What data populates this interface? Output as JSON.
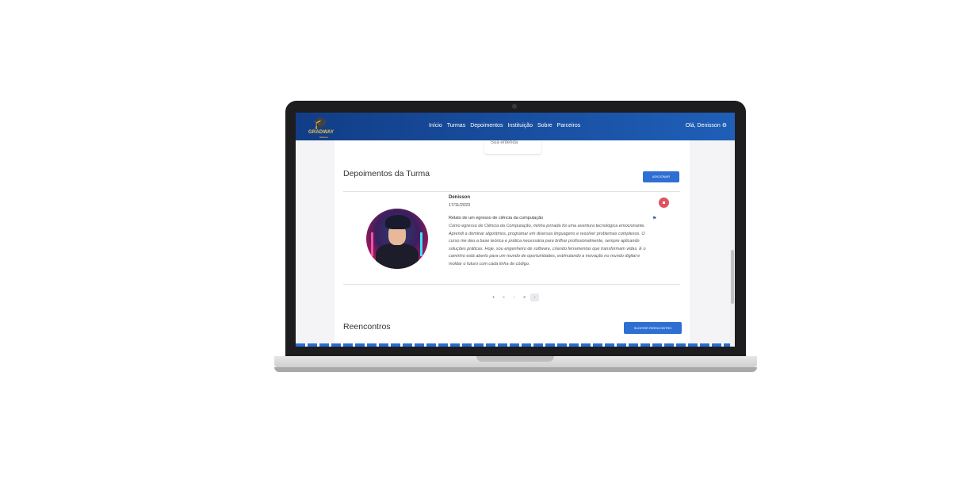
{
  "app": {
    "logo_text": "GRADWAY",
    "logo_sub": "Sistema"
  },
  "nav": {
    "items": [
      {
        "label": "Início"
      },
      {
        "label": "Turmas"
      },
      {
        "label": "Depoimentos"
      },
      {
        "label": "Instituição"
      },
      {
        "label": "Sobre"
      },
      {
        "label": "Parceiros"
      }
    ],
    "user_label": "Olá, Denisson",
    "user_icon": "gear-icon"
  },
  "previous_card": {
    "label": "Sua entenda"
  },
  "testimonials": {
    "title": "Depoimentos da Turma",
    "add_button": "ADICIONAR",
    "item": {
      "author": "Denisson",
      "date": "17/11/2023",
      "headline": "Relato de um egresso de ciência da computação",
      "body": "Como egresso de Ciência da Computação, minha jornada foi uma aventura tecnológica emocionante. Aprendi a dominar algoritmos, programar em diversas linguagens e resolver problemas complexos. O curso me deu a base teórica e prática necessária para brilhar profissionalmente, sempre aplicando soluções práticas. Hoje, sou engenheiro de software, criando ferramentas que transformam vidas. E o caminho está aberto para um mundo de oportunidades, estimulando a inovação no mundo digital e moldar o futuro com cada linha de código.",
      "delete_icon": "trash-icon",
      "report_icon": "flag-icon"
    },
    "pagination": [
      "1",
      "«",
      "‹",
      "2",
      "›"
    ],
    "active_page_index": 4
  },
  "reencontros": {
    "title": "Reencontros",
    "suggest_button": "SUGERIR REENCONTRO"
  }
}
